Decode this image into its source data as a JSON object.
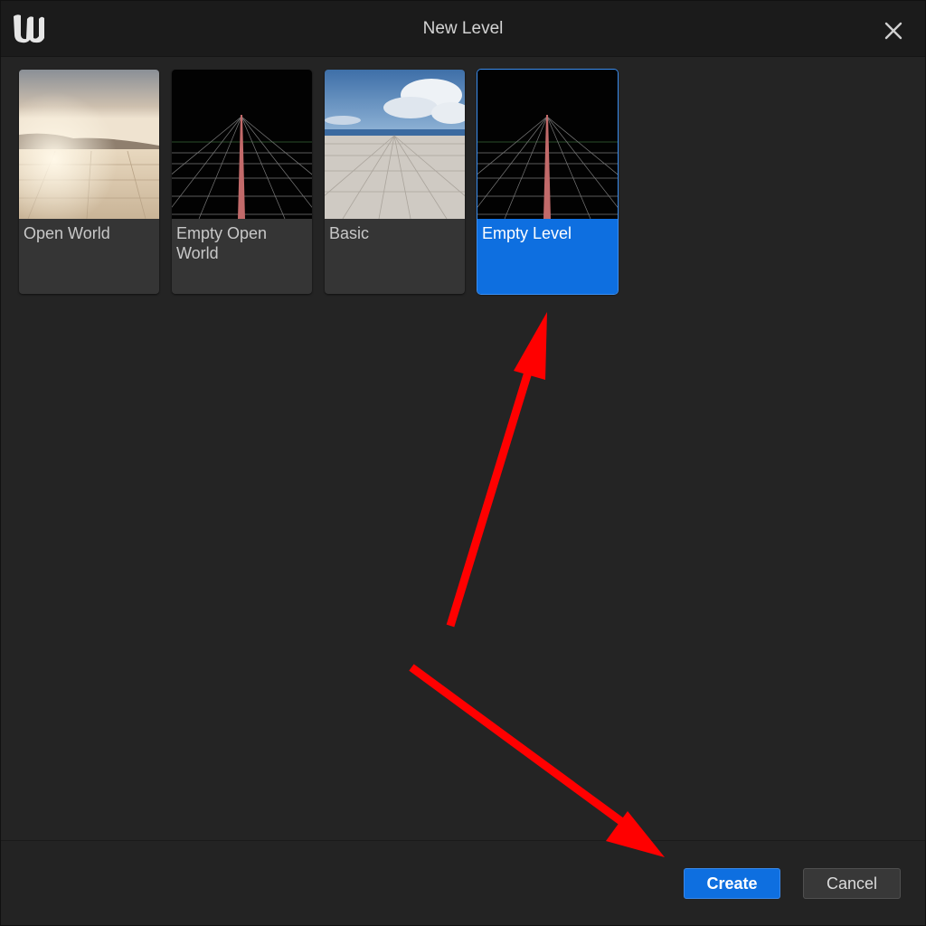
{
  "window": {
    "title": "New Level"
  },
  "icons": {
    "logo": "unreal-logo-icon",
    "close": "close-icon"
  },
  "templates": [
    {
      "label": "Open World",
      "thumbnail": "sunset-checkered-plain",
      "selected": false
    },
    {
      "label": "Empty Open World",
      "thumbnail": "black-grid-horizon",
      "selected": false
    },
    {
      "label": "Basic",
      "thumbnail": "sky-checkered-floor",
      "selected": false
    },
    {
      "label": "Empty Level",
      "thumbnail": "black-grid-horizon",
      "selected": true
    }
  ],
  "buttons": {
    "create": "Create",
    "cancel": "Cancel"
  },
  "annotations": {
    "arrow_color": "#ff0000",
    "arrows": [
      "points-to-empty-level",
      "points-to-create-button"
    ]
  },
  "colors": {
    "accent": "#0e6fe0",
    "background": "#242424",
    "titlebar": "#1b1b1b"
  }
}
